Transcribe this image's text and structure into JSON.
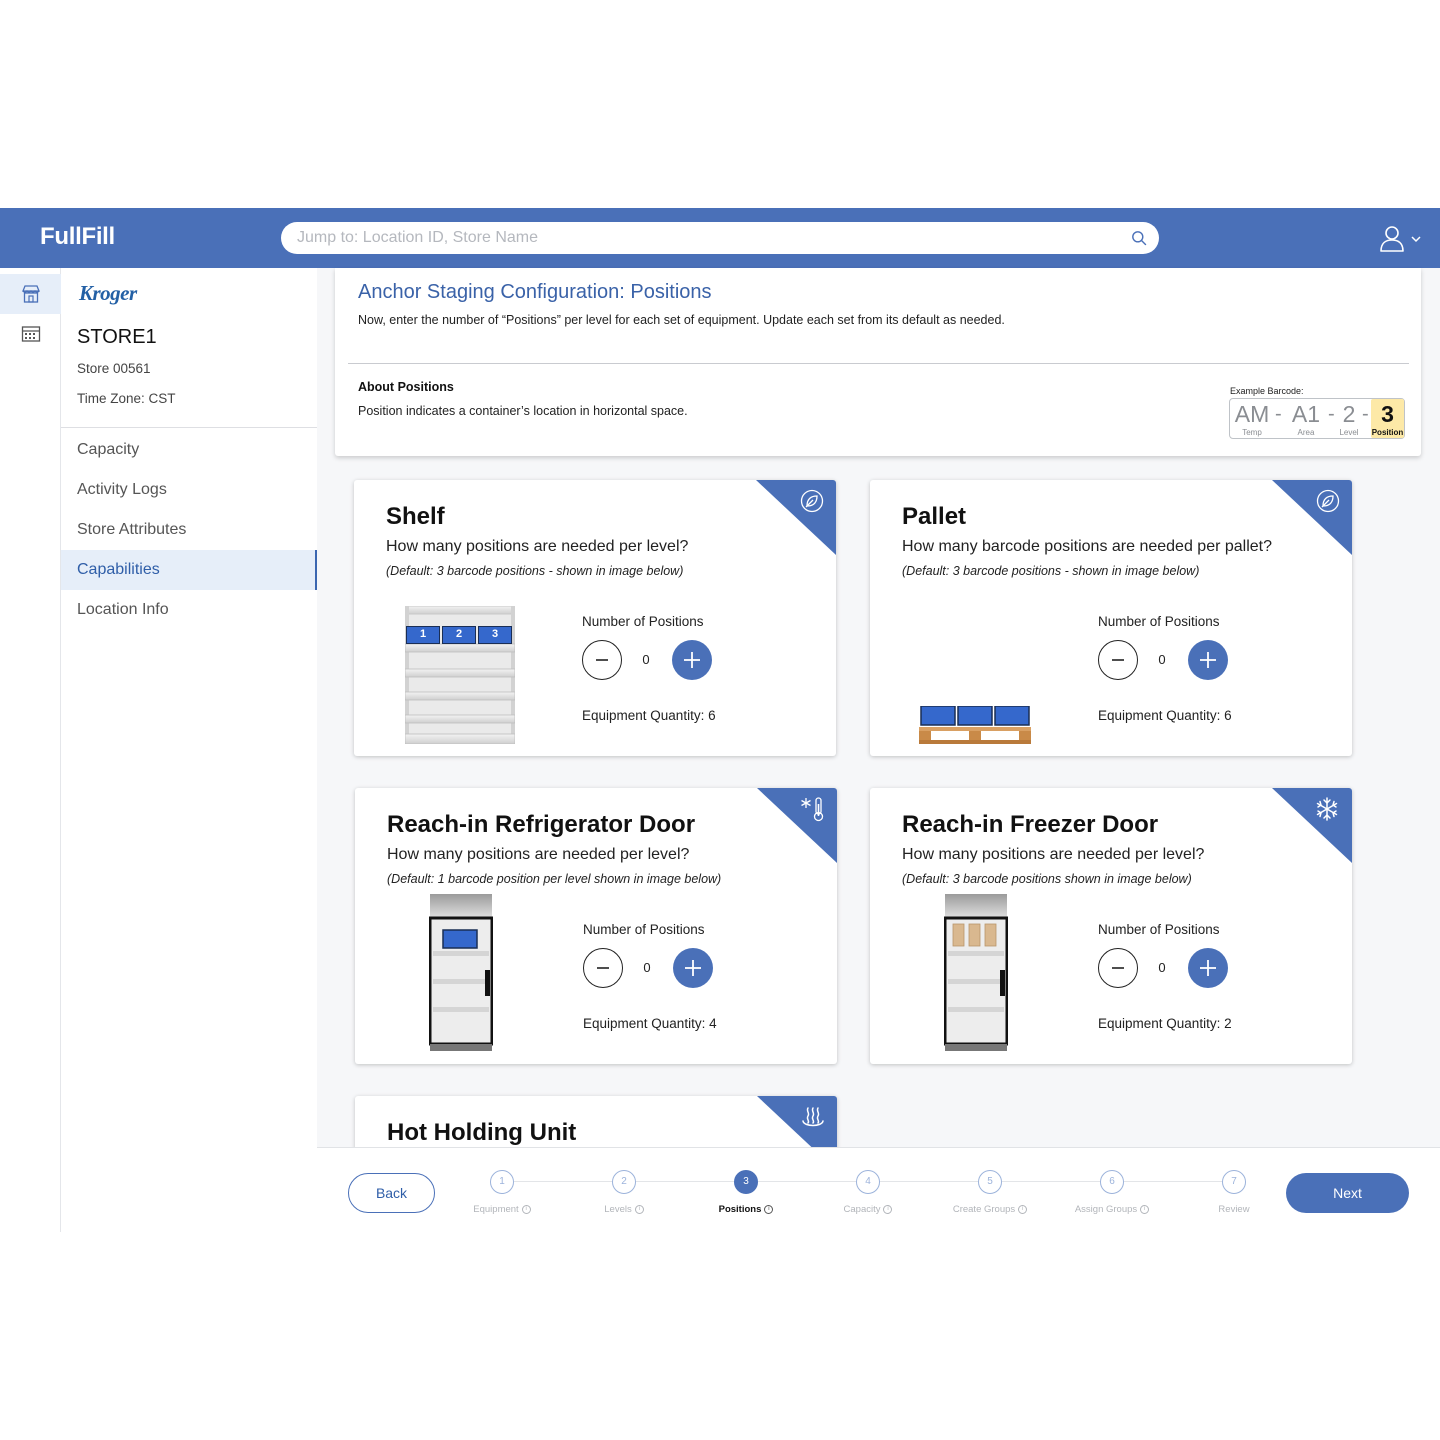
{
  "app": {
    "title": "FullFill"
  },
  "search": {
    "placeholder": "Jump to: Location ID, Store Name"
  },
  "icons": {
    "search": "search-icon",
    "user": "user-icon",
    "chevron": "chevron-down-icon",
    "store": "store-icon",
    "calendar": "calendar-icon"
  },
  "colors": {
    "brand": "#4a70b8",
    "accent_bg": "#e6eef9",
    "highlight": "#fde9a7"
  },
  "sidebar": {
    "logo": "Kroger",
    "store_name": "STORE1",
    "store_id": "Store 00561",
    "time_zone": "Time Zone: CST",
    "items": [
      {
        "label": "Capacity"
      },
      {
        "label": "Activity Logs"
      },
      {
        "label": "Store Attributes"
      },
      {
        "label": "Capabilities",
        "active": true
      },
      {
        "label": "Location Info"
      }
    ]
  },
  "header": {
    "title": "Anchor Staging Configuration: Positions",
    "subtitle": "Now, enter the number of “Positions” per level for each set of equipment. Update each set from its default as needed.",
    "about_title": "About Positions",
    "about_text": "Position indicates a container’s location in horizontal space.",
    "barcode": {
      "label": "Example Barcode:",
      "segments": [
        {
          "value": "AM",
          "caption": "Temp"
        },
        {
          "value": "A1",
          "caption": "Area"
        },
        {
          "value": "2",
          "caption": "Level"
        },
        {
          "value": "3",
          "caption": "Position",
          "highlighted": true
        }
      ],
      "separator": "-"
    }
  },
  "cards": [
    {
      "title": "Shelf",
      "question": "How many positions are needed per level?",
      "default": "(Default: 3 barcode positions - shown in image below)",
      "control_label": "Number of Positions",
      "value": "0",
      "quantity": "Equipment Quantity: 6",
      "badge_icon": "leaf-icon",
      "slots": [
        "1",
        "2",
        "3"
      ]
    },
    {
      "title": "Pallet",
      "question": "How many barcode positions are needed per pallet?",
      "default": "(Default: 3 barcode positions - shown in image below)",
      "control_label": "Number of Positions",
      "value": "0",
      "quantity": "Equipment Quantity: 6",
      "badge_icon": "leaf-icon"
    },
    {
      "title": "Reach-in Refrigerator Door",
      "question": "How many positions are needed per level?",
      "default": "(Default: 1 barcode position per level shown in image below)",
      "control_label": "Number of Positions",
      "value": "0",
      "quantity": "Equipment Quantity: 4",
      "badge_icon": "refrigerator-thermometer-icon"
    },
    {
      "title": "Reach-in Freezer Door",
      "question": "How many positions are needed per level?",
      "default": "(Default: 3 barcode positions shown in image below)",
      "control_label": "Number of Positions",
      "value": "0",
      "quantity": "Equipment Quantity: 2",
      "badge_icon": "snowflake-icon"
    },
    {
      "title": "Hot Holding Unit",
      "badge_icon": "heat-icon"
    }
  ],
  "footer": {
    "back": "Back",
    "next": "Next",
    "steps": [
      {
        "num": "1",
        "label": "Equipment"
      },
      {
        "num": "2",
        "label": "Levels"
      },
      {
        "num": "3",
        "label": "Positions",
        "active": true
      },
      {
        "num": "4",
        "label": "Capacity"
      },
      {
        "num": "5",
        "label": "Create Groups"
      },
      {
        "num": "6",
        "label": "Assign Groups"
      },
      {
        "num": "7",
        "label": "Review"
      }
    ]
  }
}
